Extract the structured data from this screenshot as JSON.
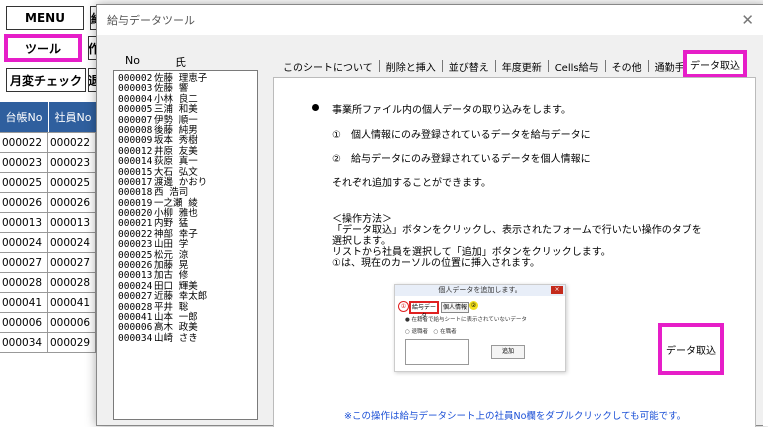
{
  "excel": {
    "menu_label": "MENU",
    "btn2_label": "給",
    "tool_label": "ツール",
    "btn4_label": "作",
    "monthly_check_label": "月変チェック",
    "btn6_label": "退",
    "col_ledger_no": "台帳No",
    "col_employee_no": "社員No",
    "rows": [
      [
        "000022",
        "000022"
      ],
      [
        "000023",
        "000023"
      ],
      [
        "000025",
        "000025"
      ],
      [
        "000026",
        "000026"
      ],
      [
        "000013",
        "000013"
      ],
      [
        "000024",
        "000024"
      ],
      [
        "000027",
        "000027"
      ],
      [
        "000028",
        "000028"
      ],
      [
        "000041",
        "000041"
      ],
      [
        "000006",
        "000006"
      ],
      [
        "000034",
        "000029"
      ]
    ]
  },
  "dialog": {
    "title": "給与データツール",
    "close_icon": "close-icon",
    "list_header_no": "No",
    "list_header_name": "氏名",
    "employees": [
      [
        "000002",
        "佐藤 理恵子"
      ],
      [
        "000003",
        "佐藤 響"
      ],
      [
        "000004",
        "小林 良二"
      ],
      [
        "000005",
        "三浦 和美"
      ],
      [
        "000007",
        "伊勢 順一"
      ],
      [
        "000008",
        "後藤 純男"
      ],
      [
        "000009",
        "坂本 秀樹"
      ],
      [
        "000012",
        "井原 友美"
      ],
      [
        "000014",
        "荻原 真一"
      ],
      [
        "000015",
        "大石 弘文"
      ],
      [
        "000017",
        "渡邊 かおり"
      ],
      [
        "000018",
        "西 浩司"
      ],
      [
        "000019",
        "一之瀬 綾"
      ],
      [
        "000020",
        "小柳 雅也"
      ],
      [
        "000021",
        "内野 猛"
      ],
      [
        "000022",
        "神部 幸子"
      ],
      [
        "000023",
        "山田 学"
      ],
      [
        "000025",
        "松元 涼"
      ],
      [
        "000026",
        "加藤 晃"
      ],
      [
        "000013",
        "加古 修"
      ],
      [
        "000024",
        "田口 輝美"
      ],
      [
        "000027",
        "近藤 幸太郎"
      ],
      [
        "000028",
        "平井 聡"
      ],
      [
        "000041",
        "山本 一郎"
      ],
      [
        "000006",
        "高木 政美"
      ],
      [
        "000034",
        "山崎 さき"
      ]
    ],
    "tabs": [
      "このシートについて",
      "削除と挿入",
      "並び替え",
      "年度更新",
      "Cells給与",
      "その他",
      "通勤手当"
    ],
    "active_tab": "データ取込",
    "desc_main": "事業所ファイル内の個人データの取り込みをします。",
    "desc_1": "①　個人情報にのみ登録されているデータを給与データに",
    "desc_2": "②　給与データにのみ登録されているデータを個人情報に",
    "desc_3": "それぞれ追加することができます。",
    "how_title": "＜操作方法＞",
    "how_1": "「データ取込」ボタンをクリックし、表示されたフォームで行いたい操作のタブを",
    "how_2": "選択します。",
    "how_3": "リストから社員を選択して「追加」ボタンをクリックします。",
    "how_4": "①は、現在のカーソルの位置に挿入されます。",
    "thumb": {
      "title": "個人データを追加します。",
      "close": "×",
      "tab1": "給与データ",
      "tab2": "個人情報",
      "num1": "①",
      "num2": "②",
      "option_main": "● 在籍者で給与シートに表示されていないデータ",
      "option_a": "○ 退職者　○ 在職者",
      "add": "追加"
    },
    "import_button": "データ取込",
    "note": "※この操作は給与データシート上の社員No欄をダブルクリックしても可能です。"
  }
}
